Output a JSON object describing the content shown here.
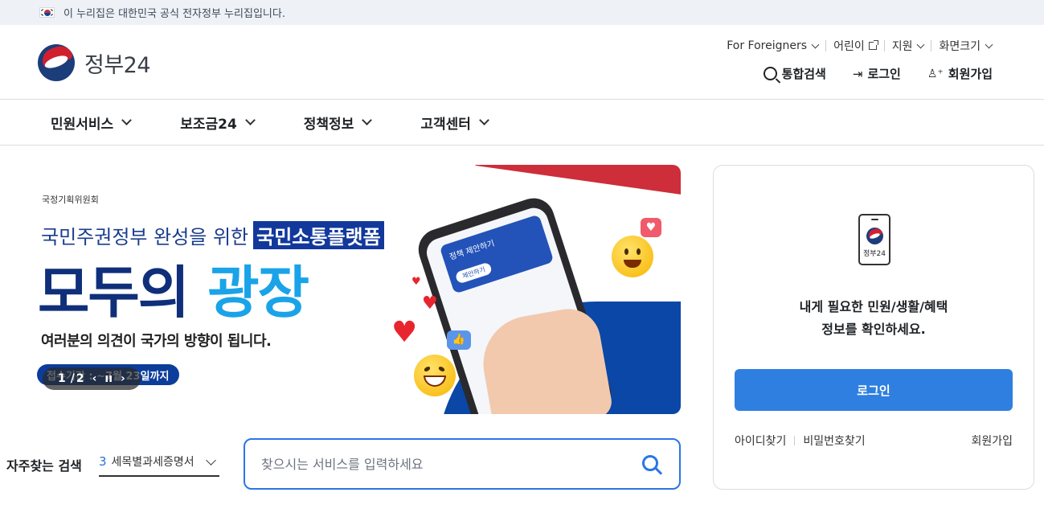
{
  "gov_banner": {
    "text": "이 누리집은 대한민국 공식 전자정부 누리집입니다.",
    "flag_icon": "korean-flag-icon"
  },
  "header": {
    "logo_text": "정부24",
    "utility": [
      {
        "label": "For Foreigners",
        "icon": "chevron-down-icon"
      },
      {
        "label": "어린이",
        "icon": "external-link-icon"
      },
      {
        "label": "지원",
        "icon": "chevron-down-icon"
      },
      {
        "label": "화면크기",
        "icon": "chevron-down-icon"
      }
    ],
    "actions": [
      {
        "label": "통합검색",
        "icon": "search-icon"
      },
      {
        "label": "로그인",
        "icon": "login-icon"
      },
      {
        "label": "회원가입",
        "icon": "add-user-icon"
      }
    ]
  },
  "nav": {
    "items": [
      {
        "label": "민원서비스"
      },
      {
        "label": "보조금24"
      },
      {
        "label": "정책정보"
      },
      {
        "label": "고객센터"
      }
    ]
  },
  "hero": {
    "org": "국정기획위원회",
    "subtitle_prefix": "국민주권정부 완성을 위한",
    "subtitle_highlight": "국민소통플랫폼",
    "title_part1": "모두의",
    "title_part2": "광장",
    "description": "여러분의 의견이 국가의 방향이 됩니다.",
    "period": "접수기간 : ~7월 23일까지",
    "slide_current": "1",
    "slide_sep": "/",
    "slide_total": "2",
    "phone_card_title": "정책 제안하기",
    "phone_card_btn": "제안하기",
    "colors": {
      "primary": "#2f7fe0",
      "navy": "#0f2f7a",
      "sky": "#1aa3e8",
      "red": "#cd2e3a"
    }
  },
  "frequent_search": {
    "label": "자주찾는 검색",
    "rank": "3",
    "item": "세목별과세증명서"
  },
  "search": {
    "placeholder": "찾으시는 서비스를 입력하세요"
  },
  "login_card": {
    "device_label": "정부24",
    "message_line1": "내게 필요한 민원/생활/혜택",
    "message_line2": "정보를 확인하세요.",
    "login_button": "로그인",
    "find_id": "아이디찾기",
    "find_pw": "비밀번호찾기",
    "signup": "회원가입"
  }
}
